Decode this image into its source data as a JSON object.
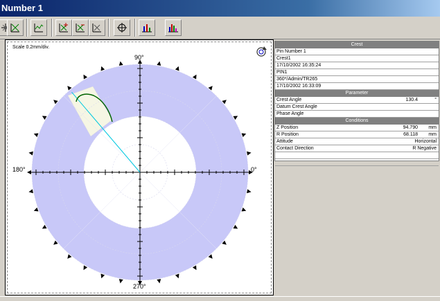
{
  "window": {
    "title": "Number 1"
  },
  "plot": {
    "scale_label": "Scale 0.2mm/div.",
    "angle_90": "90°",
    "angle_0": "0°",
    "angle_180": "180°",
    "angle_270": "270°",
    "crest_angle_deg": 130.4,
    "colors": {
      "ring": "#c8c8f8",
      "indicator": "#00c8e0",
      "crest": "#006400",
      "highlight": "#f6f6e4"
    }
  },
  "panel": {
    "crest": {
      "header": "Crest",
      "lines": [
        "Pin Number 1",
        "Crest1",
        "17/10/2002 16:35:24",
        "PIN1",
        "360*/Admin/TR265",
        "17/10/2002 16:33:09"
      ]
    },
    "parameter": {
      "header": "Parameter",
      "rows": [
        {
          "label": "Crest Angle",
          "value": "130.4",
          "unit": "°"
        },
        {
          "label": "Datum Crest Angle",
          "value": "",
          "unit": ""
        },
        {
          "label": "Phase Angle",
          "value": "",
          "unit": ""
        }
      ]
    },
    "conditions": {
      "header": "Conditions",
      "rows": [
        {
          "label": "Z Position",
          "value": "94.790",
          "unit": "mm"
        },
        {
          "label": "R Position",
          "value": "68.118",
          "unit": "mm"
        }
      ],
      "attitude": {
        "label": "Attitude",
        "value": "Horizontal"
      },
      "contact": {
        "label": "Contact Direction",
        "value": "R Negative"
      }
    }
  }
}
